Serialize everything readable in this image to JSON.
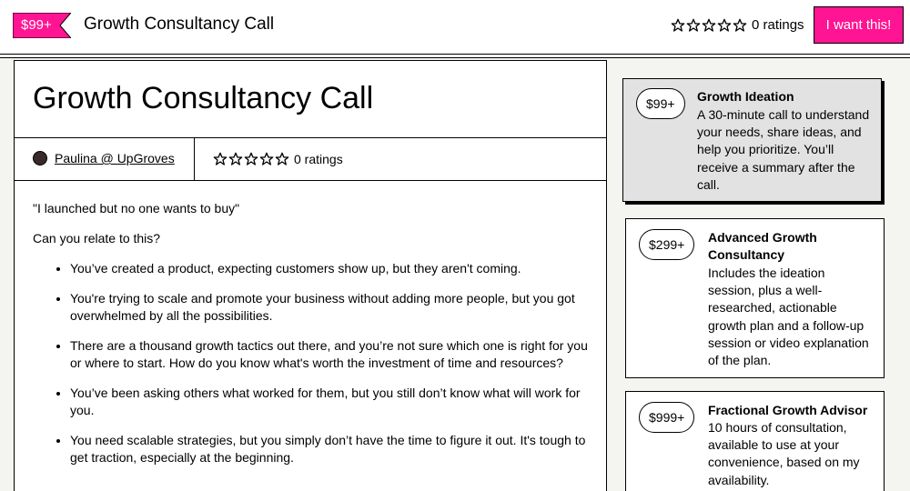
{
  "header": {
    "price_badge": "$99+",
    "title": "Growth Consultancy Call",
    "rating_text": "0 ratings",
    "cta_label": "I want this!"
  },
  "product": {
    "title": "Growth Consultancy Call",
    "author": "Paulina @ UpGroves",
    "rating_text": "0 ratings"
  },
  "description": {
    "paragraphs": [
      "\"I launched but no one wants to buy\"",
      "Can you relate to this?"
    ],
    "bullets": [
      "You’ve created a product, expecting customers show up, but they aren't coming.",
      "You're trying to scale and promote your business without adding more people, but you got overwhelmed by all the possibilities.",
      "There are a thousand growth tactics out there, and you’re not sure which one is right for you or where to start. How do you know what's worth the investment of time and resources?",
      "You’ve been asking others what worked for them, but you still don’t know what will work for you.",
      "You need scalable strategies, but you simply don’t have the time to figure it out. It's tough to get traction, especially at the beginning."
    ]
  },
  "tiers": [
    {
      "price": "$99+",
      "name": "Growth Ideation",
      "description": "A 30-minute call to understand your needs, share ideas, and help you prioritize. You’ll receive a summary after the call."
    },
    {
      "price": "$299+",
      "name": "Advanced Growth Consultancy",
      "description": "Includes the ideation session, plus a well-researched, actionable growth plan and a follow-up session or video explanation of the plan."
    },
    {
      "price": "$999+",
      "name": "Fractional Growth Advisor",
      "description": "10 hours of consultation, available to use at your convenience, based on my availability."
    }
  ],
  "colors": {
    "accent": "#ff1493",
    "selected_tier_bg": "#e2e2e2"
  }
}
